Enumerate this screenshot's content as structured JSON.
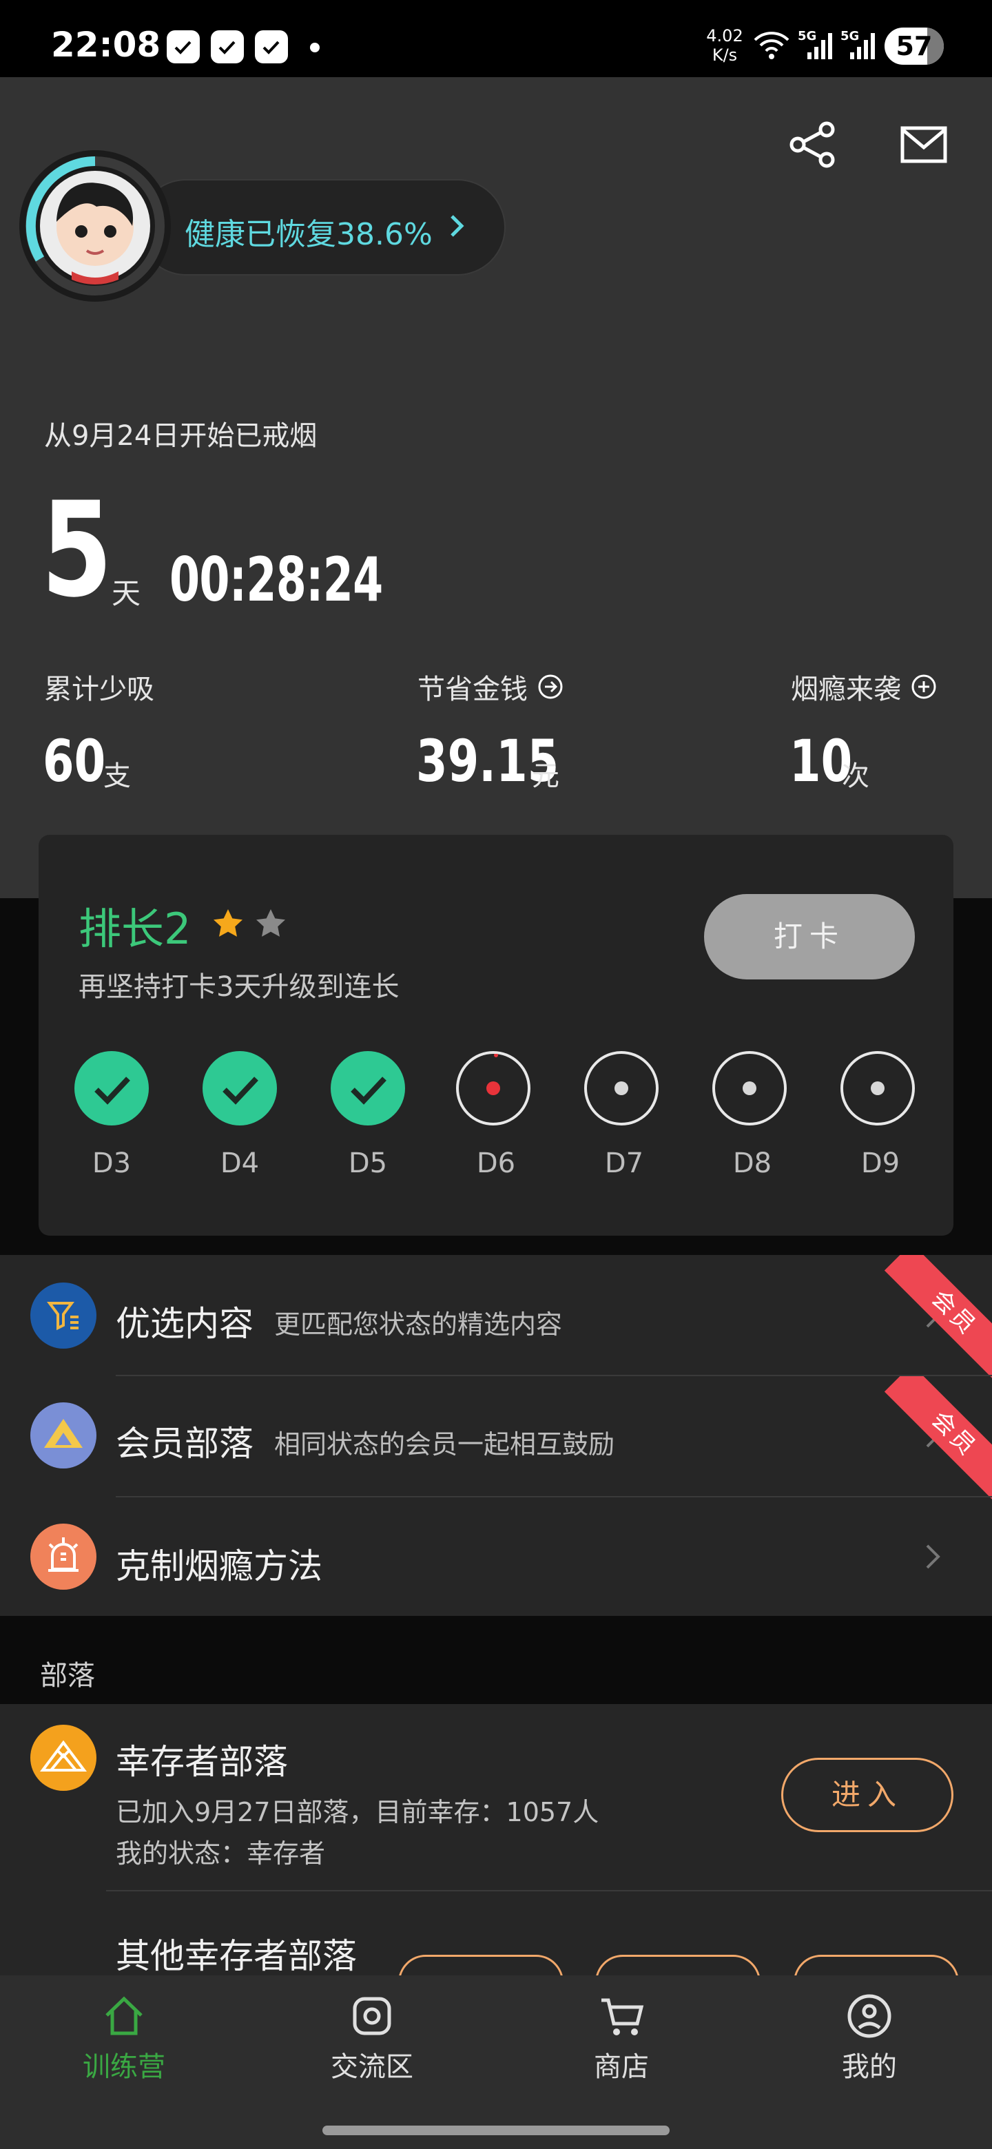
{
  "status_bar": {
    "time": "22:08",
    "net_speed_value": "4.02",
    "net_speed_unit": "K/s",
    "signal1": "5G",
    "signal2": "5G",
    "battery": "57"
  },
  "header": {
    "health_text": "健康已恢复38.6%",
    "quit_since": "从9月24日开始已戒烟",
    "days": "5",
    "days_unit": "天",
    "timer": "00:28:24"
  },
  "stats": [
    {
      "label": "累计少吸",
      "value": "60",
      "unit": "支"
    },
    {
      "label": "节省金钱",
      "value": "39.15",
      "unit": "元"
    },
    {
      "label": "烟瘾来袭",
      "value": "10",
      "unit": "次"
    }
  ],
  "rank": {
    "title": "排长2",
    "subtitle": "再坚持打卡3天升级到连长",
    "checkin_label": "打卡",
    "days": [
      {
        "label": "D3",
        "status": "done"
      },
      {
        "label": "D4",
        "status": "done"
      },
      {
        "label": "D5",
        "status": "done"
      },
      {
        "label": "D6",
        "status": "today"
      },
      {
        "label": "D7",
        "status": "pending"
      },
      {
        "label": "D8",
        "status": "pending"
      },
      {
        "label": "D9",
        "status": "pending"
      }
    ]
  },
  "features": [
    {
      "title": "优选内容",
      "desc": "更匹配您状态的精选内容",
      "badge": "会员"
    },
    {
      "title": "会员部落",
      "desc": "相同状态的会员一起相互鼓励",
      "badge": "会员"
    },
    {
      "title": "克制烟瘾方法",
      "desc": "",
      "badge": ""
    }
  ],
  "tribe_section": {
    "header": "部落",
    "name": "幸存者部落",
    "info1": "已加入9月27日部落，目前幸存：1057人",
    "info2": "我的状态：幸存者",
    "enter_label": "进入",
    "other_title": "其他幸存者部落"
  },
  "tabs": [
    {
      "label": "训练营",
      "icon": "home-icon",
      "active": true
    },
    {
      "label": "交流区",
      "icon": "chat-icon",
      "active": false
    },
    {
      "label": "商店",
      "icon": "cart-icon",
      "active": false
    },
    {
      "label": "我的",
      "icon": "profile-icon",
      "active": false
    }
  ],
  "colors": {
    "accent_green": "#3cc87a",
    "check_green": "#2ec993",
    "health_cyan": "#5fd9e0",
    "enter_orange": "#f2a86a",
    "badge_red": "#ee4752"
  }
}
